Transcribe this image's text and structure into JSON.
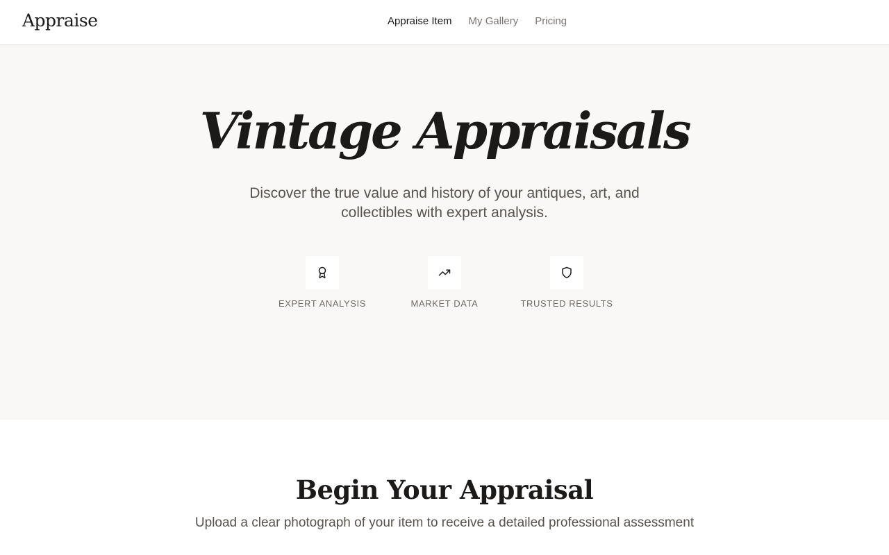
{
  "header": {
    "logo": "Appraise",
    "nav": [
      {
        "label": "Appraise Item",
        "active": true
      },
      {
        "label": "My Gallery",
        "active": false
      },
      {
        "label": "Pricing",
        "active": false
      }
    ]
  },
  "hero": {
    "title": "Vintage Appraisals",
    "subtitle": "Discover the true value and history of your antiques, art, and collectibles with expert analysis.",
    "features": [
      {
        "icon": "award-ribbon-icon",
        "label": "EXPERT ANALYSIS"
      },
      {
        "icon": "trending-up-icon",
        "label": "MARKET DATA"
      },
      {
        "icon": "shield-icon",
        "label": "TRUSTED RESULTS"
      }
    ]
  },
  "appraisal": {
    "title": "Begin Your Appraisal",
    "subtitle": "Upload a clear photograph of your item to receive a detailed professional assessment"
  },
  "colors": {
    "text": "#1c1a19",
    "muted": "#57534f",
    "hero_bg": "#f9f8f6",
    "border": "#e6e4e1"
  }
}
